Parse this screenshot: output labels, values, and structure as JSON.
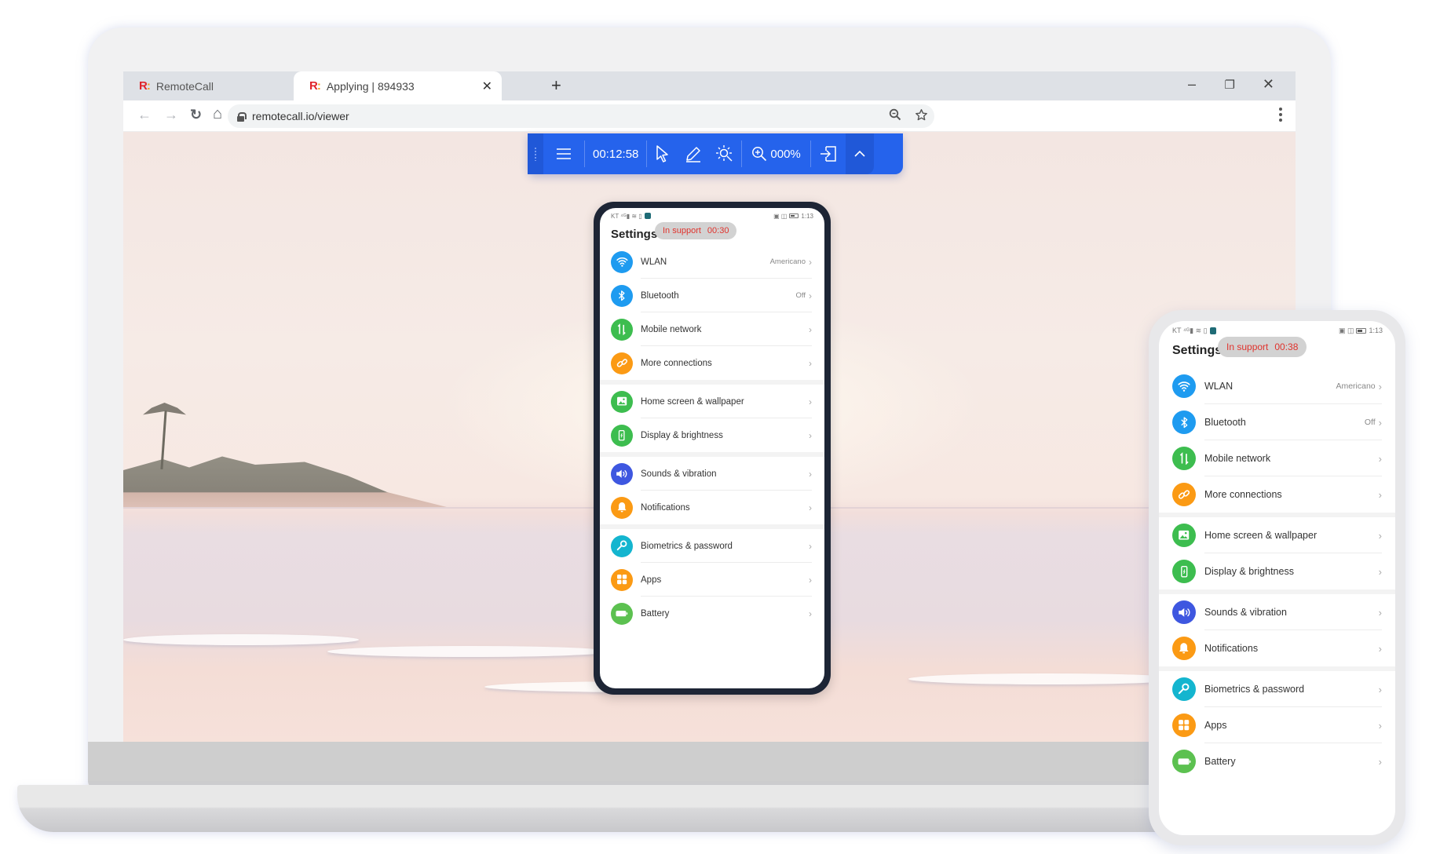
{
  "browser": {
    "tabs": [
      {
        "favicon": "remotecall-logo",
        "title": "RemoteCall",
        "active": false
      },
      {
        "favicon": "remotecall-logo",
        "title": "Applying | 894933",
        "active": true
      }
    ],
    "close_glyph": "✕",
    "new_tab_glyph": "+",
    "window_controls": {
      "minimize": "–",
      "restore": "❐",
      "close": "✕"
    },
    "nav": {
      "back": "←",
      "forward": "→",
      "reload": "↻",
      "home": "⌂"
    },
    "url": "remotecall.io/viewer",
    "omnibox_icons": [
      "zoom-icon",
      "star-icon"
    ]
  },
  "toolbar": {
    "menu_icon": "hamburger-icon",
    "session_timer": "00:12:58",
    "tools": [
      "pointer-icon",
      "pen-icon",
      "laser-icon"
    ],
    "zoom_level": "000%",
    "exit_icon": "exit-icon",
    "collapse_icon": "chevron-up-icon",
    "accent_color": "#2563ec"
  },
  "phones": {
    "center": {
      "status_left": "KT ⁴ᴳ▮ ≋ ▯",
      "status_right_time": "1:13",
      "title": "Settings",
      "support_label": "In support",
      "support_timer": "00:30"
    },
    "right": {
      "status_left": "KT ⁴ᴳ▮ ≋ ▯",
      "status_right_time": "1:13",
      "title": "Settings",
      "support_label": "In support",
      "support_timer": "00:38"
    },
    "settings_groups": [
      [
        {
          "label": "WLAN",
          "value": "Americano",
          "icon": "wifi-icon",
          "color": "#1e9bf0"
        },
        {
          "label": "Bluetooth",
          "value": "Off",
          "icon": "bluetooth-icon",
          "color": "#1e9bf0"
        },
        {
          "label": "Mobile network",
          "value": "",
          "icon": "mobile-data-icon",
          "color": "#3dbd4f"
        },
        {
          "label": "More connections",
          "value": "",
          "icon": "link-icon",
          "color": "#fb9a14"
        }
      ],
      [
        {
          "label": "Home screen & wallpaper",
          "value": "",
          "icon": "image-icon",
          "color": "#3dbd4f"
        },
        {
          "label": "Display & brightness",
          "value": "",
          "icon": "display-icon",
          "color": "#3dbd4f"
        }
      ],
      [
        {
          "label": "Sounds & vibration",
          "value": "",
          "icon": "speaker-icon",
          "color": "#3e57e0"
        },
        {
          "label": "Notifications",
          "value": "",
          "icon": "bell-icon",
          "color": "#fb9a14"
        }
      ],
      [
        {
          "label": "Biometrics & password",
          "value": "",
          "icon": "key-icon",
          "color": "#14b5cf"
        },
        {
          "label": "Apps",
          "value": "",
          "icon": "apps-grid-icon",
          "color": "#fb9a14"
        },
        {
          "label": "Battery",
          "value": "",
          "icon": "battery-icon",
          "color": "#5cc150"
        }
      ]
    ],
    "chevron": "›"
  }
}
